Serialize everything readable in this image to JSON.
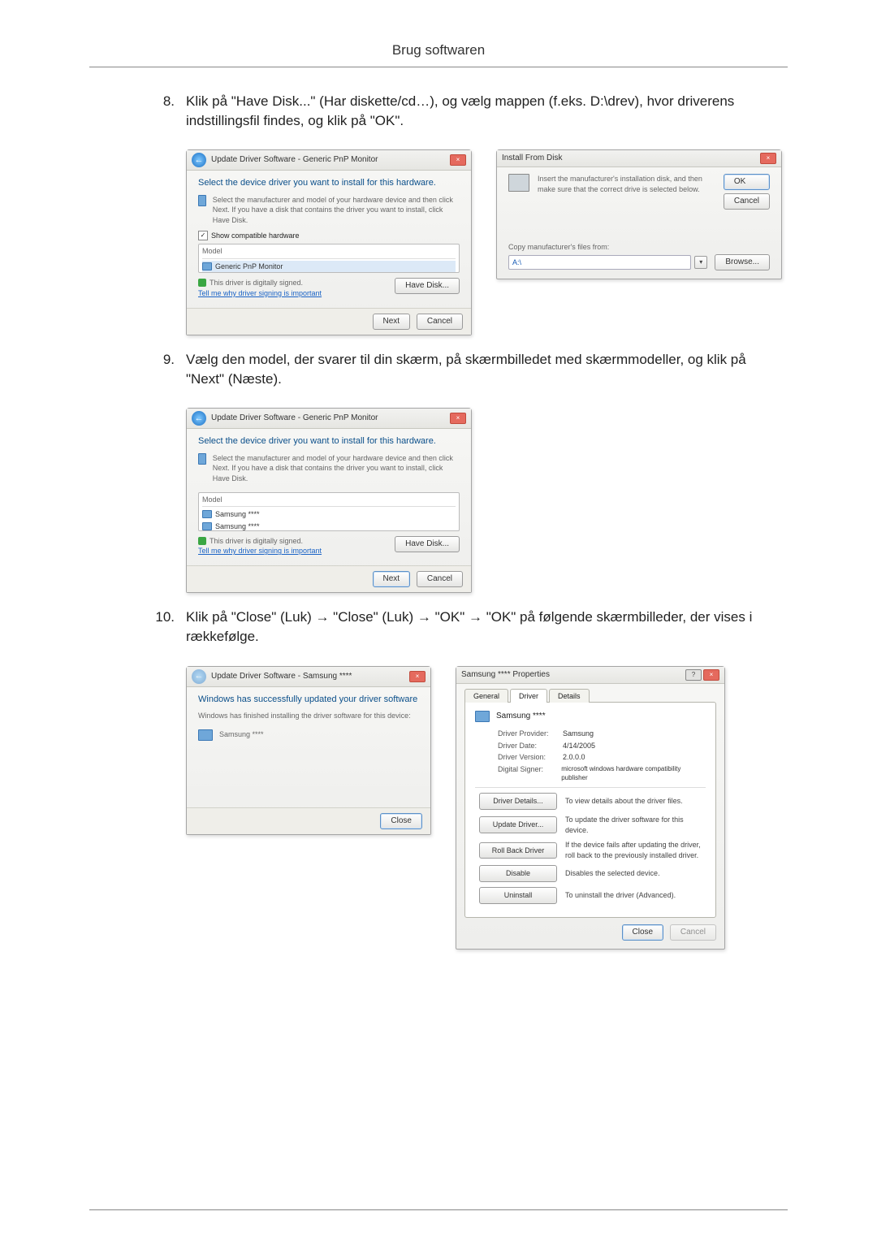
{
  "page": {
    "title": "Brug softwaren"
  },
  "s8": {
    "num": "8.",
    "text": "Klik på \"Have Disk...\" (Har diskette/cd…), og vælg mappen (f.eks. D:\\drev), hvor driverens indstillingsfil findes, og klik på \"OK\"."
  },
  "s9": {
    "num": "9.",
    "text": "Vælg den model, der svarer til din skærm, på skærmbilledet med skærmmodeller, og klik på \"Next\" (Næste)."
  },
  "s10": {
    "num": "10.",
    "text": "Klik på \"Close\" (Luk) → \"Close\" (Luk) → \"OK\" → \"OK\" på følgende skærmbilleder, der vises i rækkefølge."
  },
  "dlg_update": {
    "title": "Update Driver Software - Generic PnP Monitor",
    "heading": "Select the device driver you want to install for this hardware.",
    "desc": "Select the manufacturer and model of your hardware device and then click Next. If you have a disk that contains the driver you want to install, click Have Disk.",
    "check_label": "Show compatible hardware",
    "model_hdr": "Model",
    "item1": "Generic PnP Monitor",
    "signed": "This driver is digitally signed.",
    "signed_link": "Tell me why driver signing is important",
    "have_disk": "Have Disk...",
    "next": "Next",
    "cancel": "Cancel"
  },
  "dlg_install": {
    "title": "Install From Disk",
    "msg": "Insert the manufacturer's installation disk, and then make sure that the correct drive is selected below.",
    "copy_label": "Copy manufacturer's files from:",
    "path": "A:\\",
    "ok": "OK",
    "cancel": "Cancel",
    "browse": "Browse..."
  },
  "dlg_update2": {
    "title": "Update Driver Software - Generic PnP Monitor",
    "heading": "Select the device driver you want to install for this hardware.",
    "desc": "Select the manufacturer and model of your hardware device and then click Next. If you have a disk that contains the driver you want to install, click Have Disk.",
    "model_hdr": "Model",
    "item1": "Samsung ****",
    "item2": "Samsung ****",
    "signed": "This driver is digitally signed.",
    "signed_link": "Tell me why driver signing is important",
    "have_disk": "Have Disk...",
    "next": "Next",
    "cancel": "Cancel"
  },
  "dlg_done": {
    "title": "Update Driver Software - Samsung ****",
    "heading": "Windows has successfully updated your driver software",
    "desc": "Windows has finished installing the driver software for this device:",
    "device": "Samsung ****",
    "close": "Close"
  },
  "dlg_props": {
    "title": "Samsung **** Properties",
    "tab_general": "General",
    "tab_driver": "Driver",
    "tab_details": "Details",
    "device": "Samsung ****",
    "provider_k": "Driver Provider:",
    "provider_v": "Samsung",
    "date_k": "Driver Date:",
    "date_v": "4/14/2005",
    "version_k": "Driver Version:",
    "version_v": "2.0.0.0",
    "signer_k": "Digital Signer:",
    "signer_v": "microsoft windows hardware compatibility publisher",
    "btn_details": "Driver Details...",
    "desc_details": "To view details about the driver files.",
    "btn_update": "Update Driver...",
    "desc_update": "To update the driver software for this device.",
    "btn_rollback": "Roll Back Driver",
    "desc_rollback": "If the device fails after updating the driver, roll back to the previously installed driver.",
    "btn_disable": "Disable",
    "desc_disable": "Disables the selected device.",
    "btn_uninstall": "Uninstall",
    "desc_uninstall": "To uninstall the driver (Advanced).",
    "close": "Close",
    "cancel": "Cancel"
  }
}
